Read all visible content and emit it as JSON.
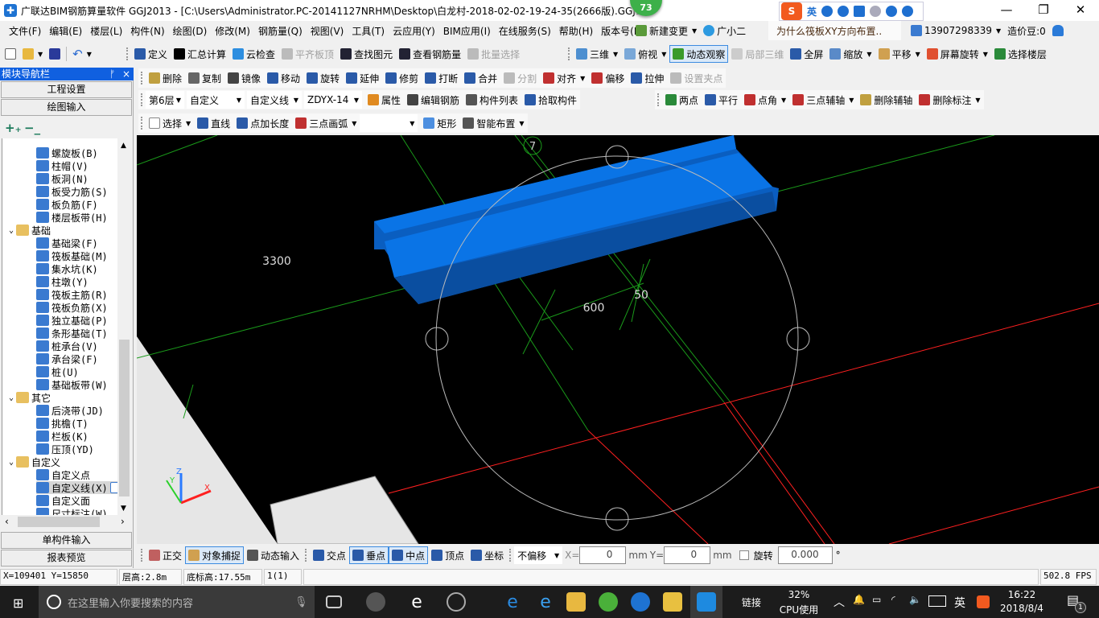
{
  "titlebar": {
    "title": "广联达BIM钢筋算量软件 GGJ2013 - [C:\\Users\\Administrator.PC-20141127NRHM\\Desktop\\白龙村-2018-02-02-19-24-35(2666版).GGJ12",
    "badge": "73",
    "ime_logo": "S",
    "ime_lang": "英"
  },
  "menu": [
    "文件(F)",
    "编辑(E)",
    "楼层(L)",
    "构件(N)",
    "绘图(D)",
    "修改(M)",
    "钢筋量(Q)",
    "视图(V)",
    "工具(T)",
    "云应用(Y)",
    "BIM应用(I)",
    "在线服务(S)",
    "帮助(H)",
    "版本号(B)"
  ],
  "menu_extra": {
    "new_change": "新建变更",
    "assistant": "广小二",
    "question": "为什么筏板XY方向布置..",
    "user": "13907298339",
    "beans": "造价豆:0"
  },
  "colors": {
    "accent": "#1060e0",
    "beam": "#0a74e6",
    "grid_green": "#1a9a1a",
    "grid_red": "#ff2020",
    "viewport_bg": "#000000"
  },
  "toolbar1_left": [
    {
      "label": "定义",
      "icon": "define-icon",
      "color": "#2a5aa8"
    },
    {
      "label": "汇总计算",
      "icon": "sigma-icon",
      "color": "#000"
    },
    {
      "label": "云检查",
      "icon": "cloud-check-icon",
      "color": "#2d8ee0"
    },
    {
      "label": "平齐板顶",
      "icon": "align-top-icon",
      "color": "#bbb",
      "state": "disabled"
    },
    {
      "label": "查找图元",
      "icon": "binoculars-icon",
      "color": "#223"
    },
    {
      "label": "查看钢筋量",
      "icon": "glasses-icon",
      "color": "#223"
    },
    {
      "label": "批量选择",
      "icon": "batch-select-icon",
      "color": "#bbb",
      "state": "disabled"
    }
  ],
  "toolbar1_right": [
    {
      "label": "三维",
      "icon": "cube-icon",
      "color": "#4d8fd0",
      "dd": true
    },
    {
      "label": "俯视",
      "icon": "top-view-icon",
      "color": "#7aa8d8",
      "dd": true
    },
    {
      "label": "动态观察",
      "icon": "orbit-icon",
      "color": "#3a9a2a",
      "state": "active"
    },
    {
      "label": "局部三维",
      "icon": "local-3d-icon",
      "color": "#ccc",
      "state": "disabled"
    },
    {
      "label": "全屏",
      "icon": "fullscreen-icon",
      "color": "#2a5aa8"
    },
    {
      "label": "缩放",
      "icon": "zoom-icon",
      "color": "#5a8ac8",
      "dd": true
    },
    {
      "label": "平移",
      "icon": "pan-hand-icon",
      "color": "#d0a050",
      "dd": true
    },
    {
      "label": "屏幕旋转",
      "icon": "screen-rotate-icon",
      "color": "#e05030",
      "dd": true
    },
    {
      "label": "选择楼层",
      "icon": "select-floor-icon",
      "color": "#2a8a3a"
    }
  ],
  "toolbar2": [
    {
      "label": "删除",
      "icon": "eraser-icon",
      "color": "#c0a040"
    },
    {
      "label": "复制",
      "icon": "copy-icon",
      "color": "#666"
    },
    {
      "label": "镜像",
      "icon": "mirror-icon",
      "color": "#444"
    },
    {
      "label": "移动",
      "icon": "move-icon",
      "color": "#2a5aa8"
    },
    {
      "label": "旋转",
      "icon": "rotate-icon",
      "color": "#2a5aa8"
    },
    {
      "label": "延伸",
      "icon": "extend-icon",
      "color": "#2a5aa8"
    },
    {
      "label": "修剪",
      "icon": "trim-icon",
      "color": "#2a5aa8"
    },
    {
      "label": "打断",
      "icon": "break-icon",
      "color": "#2a5aa8"
    },
    {
      "label": "合并",
      "icon": "merge-icon",
      "color": "#2a5aa8"
    },
    {
      "label": "分割",
      "icon": "split-icon",
      "color": "#bbb",
      "state": "disabled"
    },
    {
      "label": "对齐",
      "icon": "align-icon",
      "color": "#c03030",
      "dd": true
    },
    {
      "label": "偏移",
      "icon": "offset-icon",
      "color": "#c03030"
    },
    {
      "label": "拉伸",
      "icon": "stretch-icon",
      "color": "#2a5aa8"
    },
    {
      "label": "设置夹点",
      "icon": "grip-point-icon",
      "color": "#bbb",
      "state": "disabled"
    }
  ],
  "toolbar3": {
    "selects": [
      "第6层",
      "自定义",
      "自定义线",
      "ZDYX-14"
    ],
    "items": [
      {
        "label": "属性",
        "icon": "properties-icon",
        "color": "#e08a20"
      },
      {
        "label": "编辑钢筋",
        "icon": "edit-rebar-icon",
        "color": "#444"
      },
      {
        "label": "构件列表",
        "icon": "component-list-icon",
        "color": "#555"
      },
      {
        "label": "拾取构件",
        "icon": "pick-icon",
        "color": "#2a5aa8"
      }
    ],
    "right": [
      {
        "label": "两点",
        "icon": "two-point-axis-icon",
        "color": "#2a8a3a"
      },
      {
        "label": "平行",
        "icon": "parallel-icon",
        "color": "#2a5aa8"
      },
      {
        "label": "点角",
        "icon": "point-angle-icon",
        "color": "#c03030",
        "dd": true
      },
      {
        "label": "三点辅轴",
        "icon": "three-point-axis-icon",
        "color": "#c03030",
        "dd": true
      },
      {
        "label": "删除辅轴",
        "icon": "delete-axis-icon",
        "color": "#c0a040"
      },
      {
        "label": "删除标注",
        "icon": "delete-dimension-icon",
        "color": "#c03030",
        "dd": true
      }
    ]
  },
  "toolbar4": {
    "items": [
      {
        "label": "选择",
        "icon": "cursor-icon",
        "color": "#fff",
        "dd": true
      },
      {
        "label": "直线",
        "icon": "line-icon",
        "color": "#2a5aa8"
      },
      {
        "label": "点加长度",
        "icon": "point-length-icon",
        "color": "#2a5aa8"
      },
      {
        "label": "三点画弧",
        "icon": "arc-icon",
        "color": "#c03030",
        "dd": true
      }
    ],
    "after": [
      {
        "label": "矩形",
        "icon": "rectangle-icon",
        "color": "#4d8fe0"
      },
      {
        "label": "智能布置",
        "icon": "smart-layout-icon",
        "color": "#555",
        "dd": true
      }
    ]
  },
  "leftpanel": {
    "title": "模块导航栏",
    "project_settings": "工程设置",
    "drawing_input": "绘图输入",
    "single_input": "单构件输入",
    "report_preview": "报表预览"
  },
  "tree": [
    {
      "label": "螺旋板(B)",
      "level": 2,
      "icon": "spiral-slab-icon"
    },
    {
      "label": "柱帽(V)",
      "level": 2,
      "icon": "column-cap-icon"
    },
    {
      "label": "板洞(N)",
      "level": 2,
      "icon": "slab-hole-icon"
    },
    {
      "label": "板受力筋(S)",
      "level": 2,
      "icon": "slab-rebar-icon"
    },
    {
      "label": "板负筋(F)",
      "level": 2,
      "icon": "slab-neg-rebar-icon"
    },
    {
      "label": "楼层板带(H)",
      "level": 2,
      "icon": "floor-strip-icon"
    },
    {
      "label": "基础",
      "level": 1,
      "icon": "folder-icon"
    },
    {
      "label": "基础梁(F)",
      "level": 2,
      "icon": "foundation-beam-icon"
    },
    {
      "label": "筏板基础(M)",
      "level": 2,
      "icon": "raft-foundation-icon"
    },
    {
      "label": "集水坑(K)",
      "level": 2,
      "icon": "sump-icon"
    },
    {
      "label": "柱墩(Y)",
      "level": 2,
      "icon": "pier-icon"
    },
    {
      "label": "筏板主筋(R)",
      "level": 2,
      "icon": "raft-main-rebar-icon"
    },
    {
      "label": "筏板负筋(X)",
      "level": 2,
      "icon": "raft-neg-rebar-icon"
    },
    {
      "label": "独立基础(P)",
      "level": 2,
      "icon": "isolated-footing-icon"
    },
    {
      "label": "条形基础(T)",
      "level": 2,
      "icon": "strip-footing-icon"
    },
    {
      "label": "桩承台(V)",
      "level": 2,
      "icon": "pile-cap-icon"
    },
    {
      "label": "承台梁(F)",
      "level": 2,
      "icon": "cap-beam-icon"
    },
    {
      "label": "桩(U)",
      "level": 2,
      "icon": "pile-icon"
    },
    {
      "label": "基础板带(W)",
      "level": 2,
      "icon": "foundation-strip-icon"
    },
    {
      "label": "其它",
      "level": 1,
      "icon": "folder-icon"
    },
    {
      "label": "后浇带(JD)",
      "level": 2,
      "icon": "post-pour-icon"
    },
    {
      "label": "挑檐(T)",
      "level": 2,
      "icon": "eave-icon"
    },
    {
      "label": "栏板(K)",
      "level": 2,
      "icon": "parapet-icon"
    },
    {
      "label": "压顶(YD)",
      "level": 2,
      "icon": "coping-icon"
    },
    {
      "label": "自定义",
      "level": 1,
      "icon": "folder-icon"
    },
    {
      "label": "自定义点",
      "level": 2,
      "icon": "custom-point-icon"
    },
    {
      "label": "自定义线(X)",
      "level": 2,
      "icon": "custom-line-icon",
      "selected": true
    },
    {
      "label": "自定义面",
      "level": 2,
      "icon": "custom-face-icon"
    },
    {
      "label": "尺寸标注(W)",
      "level": 2,
      "icon": "dimension-icon"
    }
  ],
  "viewport": {
    "axis_label": "7",
    "dim_left": "3300",
    "dim_600": "600",
    "dim_50": "50",
    "axis_x": "X",
    "axis_y": "Y",
    "axis_z": "Z"
  },
  "snapbar": {
    "items": [
      {
        "label": "正交",
        "icon": "ortho-icon",
        "color": "#c06060"
      },
      {
        "label": "对象捕捉",
        "icon": "object-snap-icon",
        "color": "#d0a050",
        "state": "active"
      },
      {
        "label": "动态输入",
        "icon": "dynamic-input-icon",
        "color": "#555"
      }
    ],
    "points": [
      {
        "label": "交点",
        "icon": "intersection-icon",
        "color": "#2a5aa8"
      },
      {
        "label": "垂点",
        "icon": "perpendicular-icon",
        "color": "#2a5aa8",
        "state": "active"
      },
      {
        "label": "中点",
        "icon": "midpoint-icon",
        "color": "#2a5aa8",
        "state": "active"
      },
      {
        "label": "顶点",
        "icon": "vertex-icon",
        "color": "#2a5aa8"
      },
      {
        "label": "坐标",
        "icon": "coordinate-icon",
        "color": "#2a5aa8"
      }
    ],
    "offset": "不偏移",
    "x_label": "X=",
    "x_value": "0",
    "y_label": "Y=",
    "y_value": "0",
    "unit": "mm",
    "rotate_label": "旋转",
    "rotate_value": "0.000",
    "degree": "°",
    "rotate_checked": false
  },
  "status": {
    "coords": "X=109401 Y=15850",
    "floor_height": "层高:2.8m",
    "base_elev": "底标高:17.55m",
    "count": "1(1)",
    "fps": "502.8 FPS"
  },
  "taskbar": {
    "search_placeholder": "在这里输入你要搜索的内容",
    "link": "链接",
    "cpu_pct": "32%",
    "cpu_label": "CPU使用",
    "lang": "英",
    "time": "16:22",
    "date": "2018/8/4",
    "notif_count": "1"
  }
}
